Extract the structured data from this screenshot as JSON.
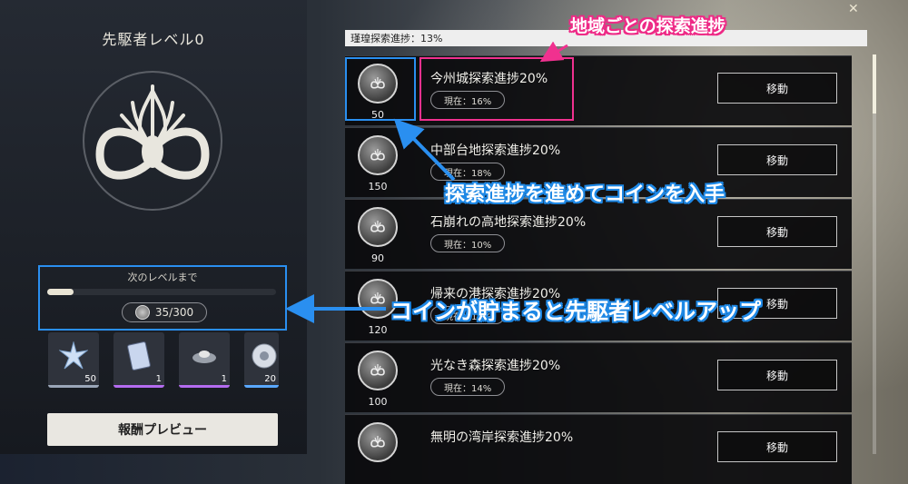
{
  "level_title": "先駆者レベル0",
  "next_level_label": "次のレベルまで",
  "coins": {
    "text": "35/300",
    "current": 35,
    "max": 300
  },
  "rewards": [
    {
      "icon": "star-crystal-icon",
      "count": "50",
      "accent": "#9aa6b8"
    },
    {
      "icon": "card-icon",
      "count": "1",
      "accent": "#b46cf0"
    },
    {
      "icon": "drone-icon",
      "count": "1",
      "accent": "#b46cf0"
    },
    {
      "icon": "disc-icon",
      "count": "20",
      "accent": "#5aa8ff"
    }
  ],
  "preview_button": "報酬プレビュー",
  "overall_progress": "瑾瑝探索進捗：13%",
  "regions": [
    {
      "coin": "50",
      "title": "今州城探索進捗20%",
      "current": "現在：16%",
      "button": "移動"
    },
    {
      "coin": "150",
      "title": "中部台地探索進捗20%",
      "current": "現在：18%",
      "button": "移動"
    },
    {
      "coin": "90",
      "title": "石崩れの高地探索進捗20%",
      "current": "現在：10%",
      "button": "移動"
    },
    {
      "coin": "120",
      "title": "帰来の港探索進捗20%",
      "current": "現在：12%",
      "button": "移動"
    },
    {
      "coin": "100",
      "title": "光なき森探索進捗20%",
      "current": "現在：14%",
      "button": "移動"
    },
    {
      "coin": "",
      "title": "無明の湾岸探索進捗20%",
      "current": "",
      "button": "移動"
    }
  ],
  "annotations": {
    "region_progress": "地域ごとの探索進捗",
    "earn_coins": "探索進捗を進めてコインを入手",
    "level_up": "コインが貯まると先駆者レベルアップ",
    "colors": {
      "blue": "#2a8ff0",
      "pink": "#f0318f"
    }
  }
}
